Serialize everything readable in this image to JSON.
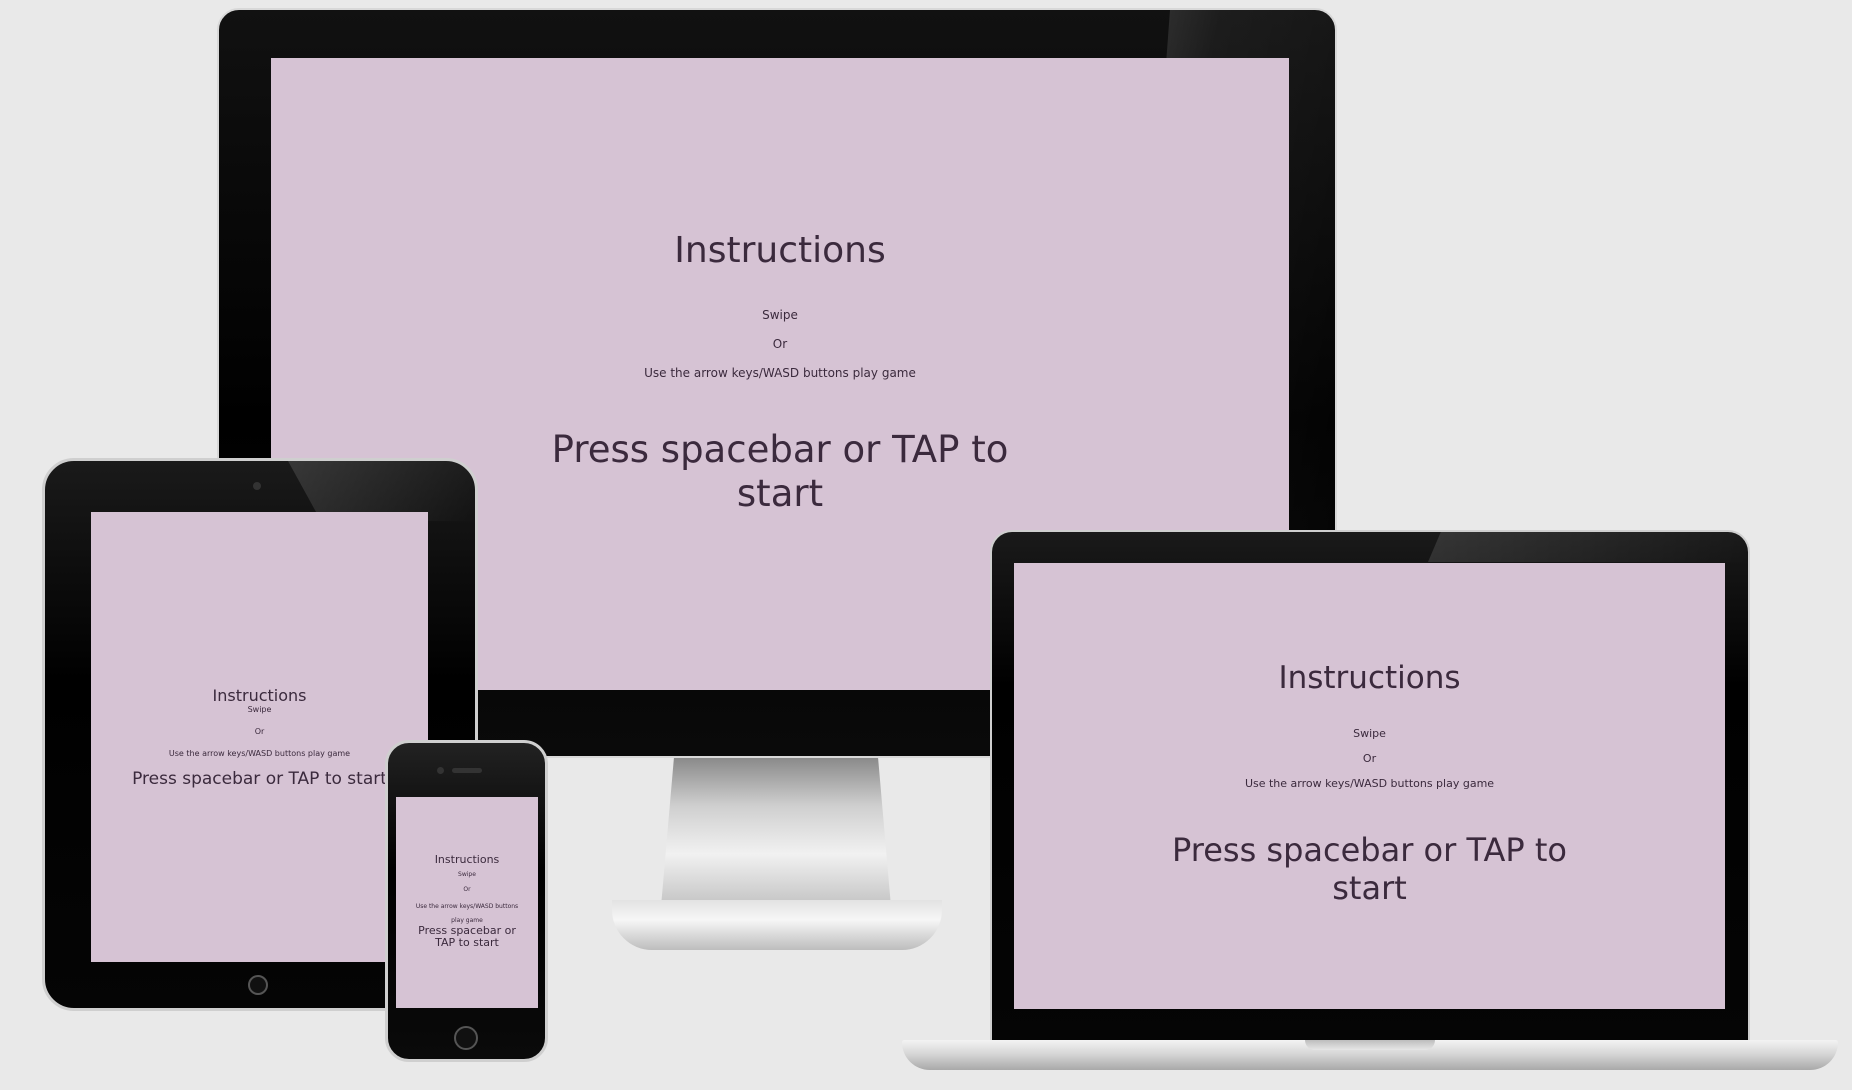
{
  "colors": {
    "background": "#e9e9e9",
    "screen_bg": "#d6c3d4",
    "screen_text": "#3b2a3d",
    "bezel": "#000000"
  },
  "instructions": {
    "title": "Instructions",
    "swipe": "Swipe",
    "or": "Or",
    "keys": "Use the arrow keys/WASD buttons play game",
    "start": "Press spacebar or TAP to start"
  }
}
